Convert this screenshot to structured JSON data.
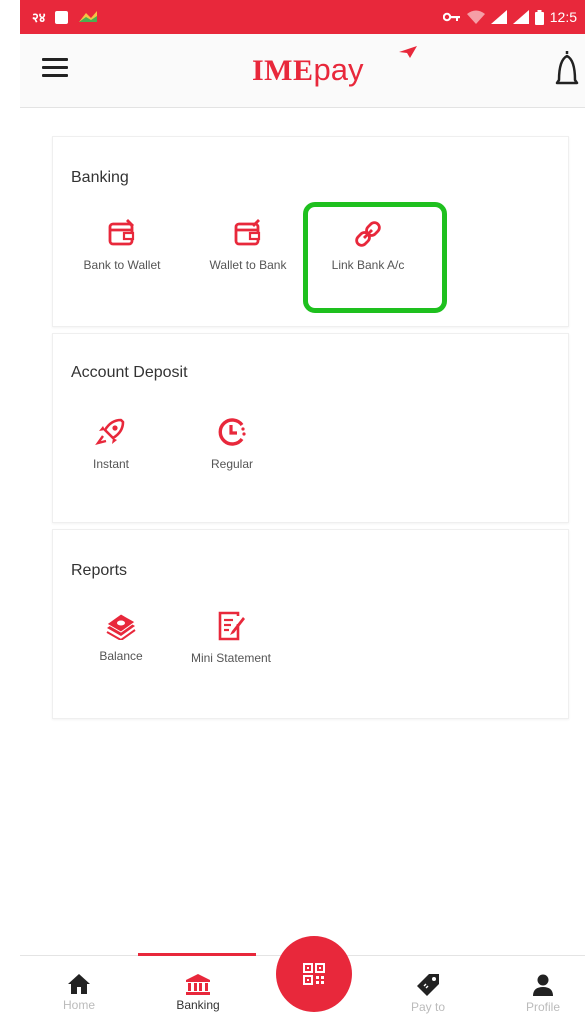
{
  "status_bar": {
    "carrier": "२४",
    "time": "12:5"
  },
  "header": {
    "logo_text": "IME",
    "logo_suffix": "pay"
  },
  "sections": {
    "banking": {
      "title": "Banking",
      "items": [
        {
          "label": "Bank to Wallet",
          "icon": "wallet-in-icon"
        },
        {
          "label": "Wallet to Bank",
          "icon": "wallet-out-icon"
        },
        {
          "label": "Link Bank A/c",
          "icon": "link-icon"
        }
      ]
    },
    "account_deposit": {
      "title": "Account Deposit",
      "items": [
        {
          "label": "Instant",
          "icon": "rocket-icon"
        },
        {
          "label": "Regular",
          "icon": "clock-icon"
        }
      ]
    },
    "reports": {
      "title": "Reports",
      "items": [
        {
          "label": "Balance",
          "icon": "cash-stack-icon"
        },
        {
          "label": "Mini Statement",
          "icon": "statement-icon"
        }
      ]
    }
  },
  "bottom_nav": {
    "items": [
      {
        "label": "Home",
        "icon": "home-icon"
      },
      {
        "label": "Banking",
        "icon": "bank-icon"
      },
      {
        "label": "Pay to",
        "icon": "tag-icon"
      },
      {
        "label": "Profile",
        "icon": "person-icon"
      }
    ],
    "active": "Banking",
    "fab_icon": "qr-code-icon"
  },
  "colors": {
    "brand_red": "#e8283b",
    "highlight_green": "#1ec01e"
  }
}
